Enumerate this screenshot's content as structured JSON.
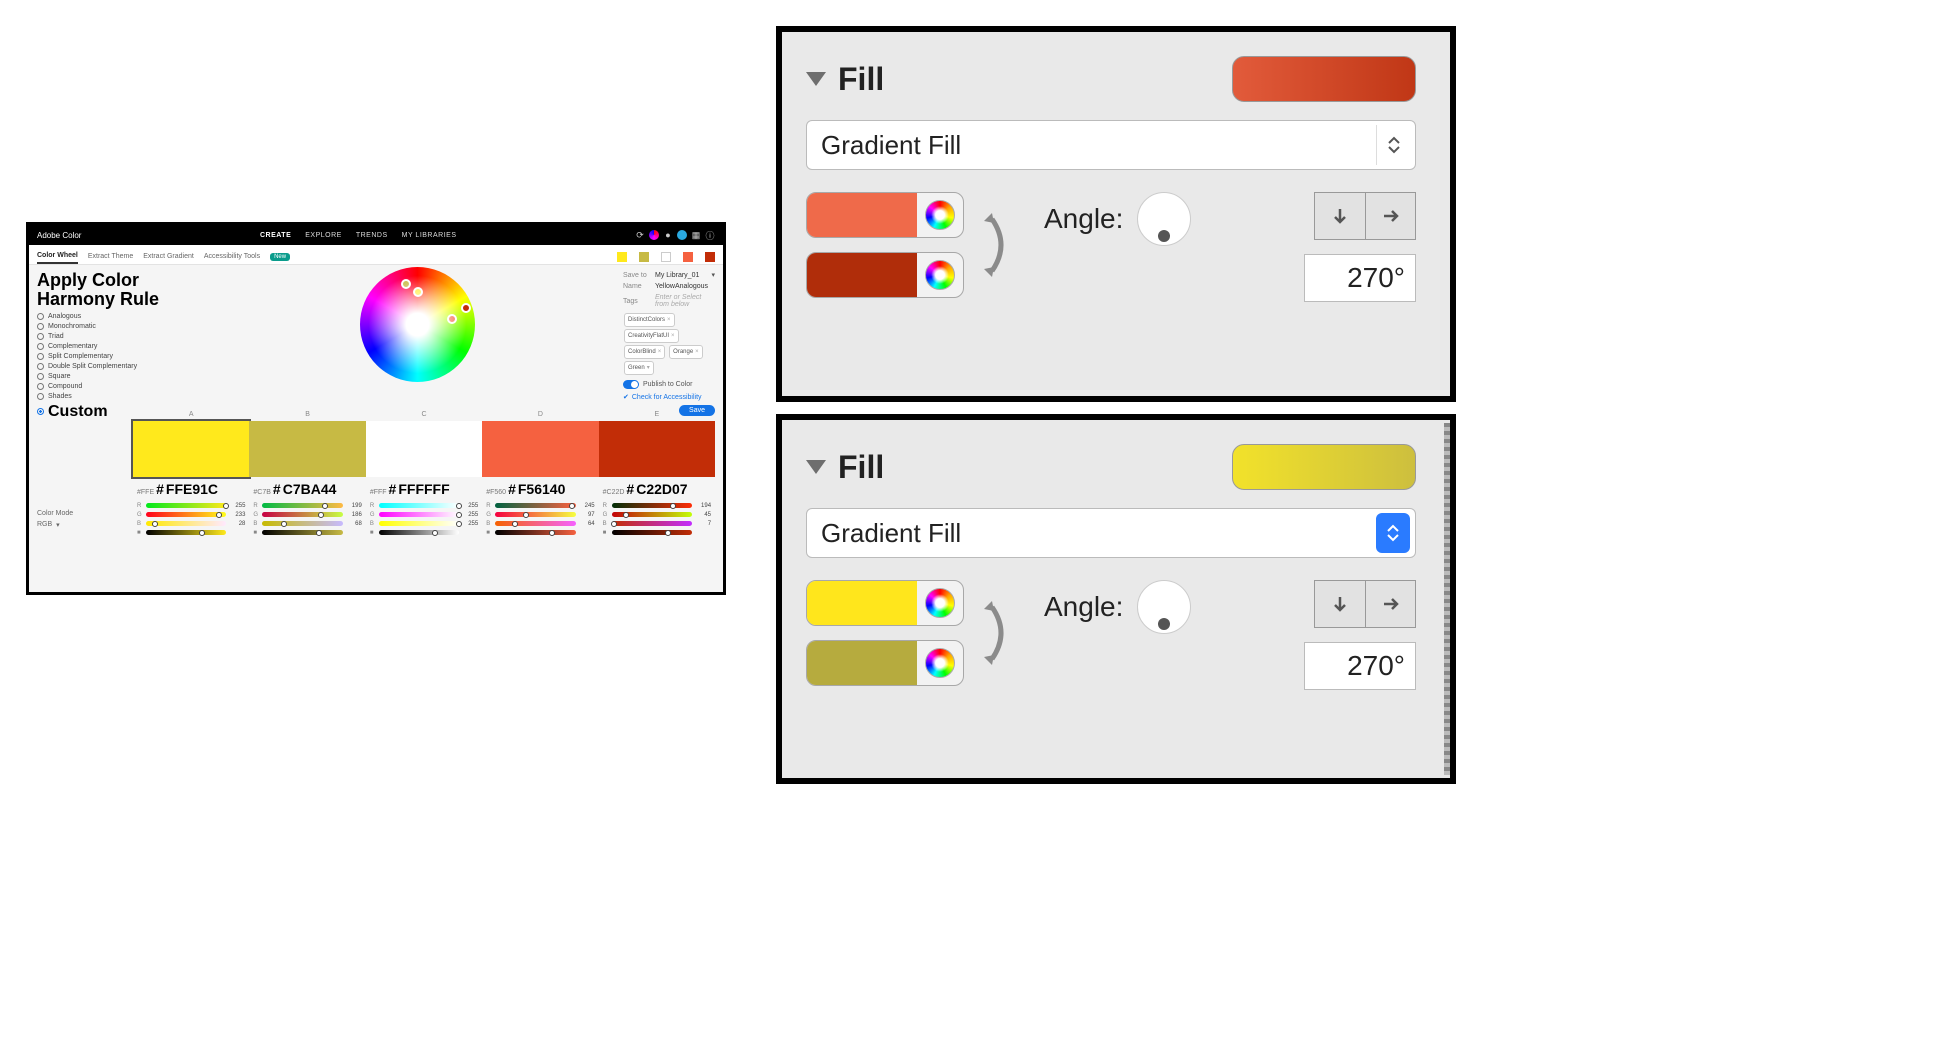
{
  "adobe": {
    "brand": "Adobe Color",
    "nav": {
      "create": "CREATE",
      "explore": "EXPLORE",
      "trends": "TRENDS",
      "mylibs": "MY LIBRARIES"
    },
    "tabs": {
      "wheel": "Color Wheel",
      "theme": "Extract Theme",
      "gradient": "Extract Gradient",
      "access": "Accessibility Tools",
      "new": "New"
    },
    "mini_swatches": [
      "#FFE91C",
      "#C7BA44",
      "#FFFFFF",
      "#F56140",
      "#C22D07"
    ],
    "heading": "Apply Color Harmony Rule",
    "rules": [
      "Analogous",
      "Monochromatic",
      "Triad",
      "Complementary",
      "Split Complementary",
      "Double Split Complementary",
      "Square",
      "Compound",
      "Shades"
    ],
    "custom_label": "Custom",
    "color_mode_label": "Color Mode",
    "color_mode_value": "RGB",
    "col_letters": [
      "A",
      "B",
      "C",
      "D",
      "E"
    ],
    "swatches": [
      {
        "hex": "FFE91C",
        "color": "#FFE91C",
        "r": 255,
        "g": 233,
        "b": 28
      },
      {
        "hex": "C7BA44",
        "color": "#C7BA44",
        "r": 199,
        "g": 186,
        "b": 68
      },
      {
        "hex": "FFFFFF",
        "color": "#FFFFFF",
        "r": 255,
        "g": 255,
        "b": 255
      },
      {
        "hex": "F56140",
        "color": "#F56140",
        "r": 245,
        "g": 97,
        "b": 64
      },
      {
        "hex": "C22D07",
        "color": "#C22D07",
        "r": 194,
        "g": 45,
        "b": 7
      }
    ],
    "side": {
      "saveto_label": "Save to",
      "saveto_value": "My Library_01",
      "name_label": "Name",
      "name_value": "YellowAnalogous",
      "tags_label": "Tags",
      "tags_placeholder": "Enter or Select from below",
      "tags": [
        "DistinctColors",
        "CreativityFlatUI",
        "ColorBlind",
        "Orange",
        "Green"
      ],
      "publish_label": "Publish to Color",
      "access_label": "Check for Accessibility",
      "save_label": "Save"
    }
  },
  "fill1": {
    "title": "Fill",
    "select_value": "Gradient Fill",
    "swatch_gradient": {
      "from": "#e25b3b",
      "to": "#c03716"
    },
    "stops": [
      {
        "color": "#ef6a4a"
      },
      {
        "color": "#b02d0a"
      }
    ],
    "angle_label": "Angle:",
    "angle_value": "270°"
  },
  "fill2": {
    "title": "Fill",
    "select_value": "Gradient Fill",
    "swatch_gradient": {
      "from": "#f2e22a",
      "to": "#cdbf3e"
    },
    "stops": [
      {
        "color": "#ffe61c"
      },
      {
        "color": "#b6ab3e"
      }
    ],
    "angle_label": "Angle:",
    "angle_value": "270°"
  }
}
